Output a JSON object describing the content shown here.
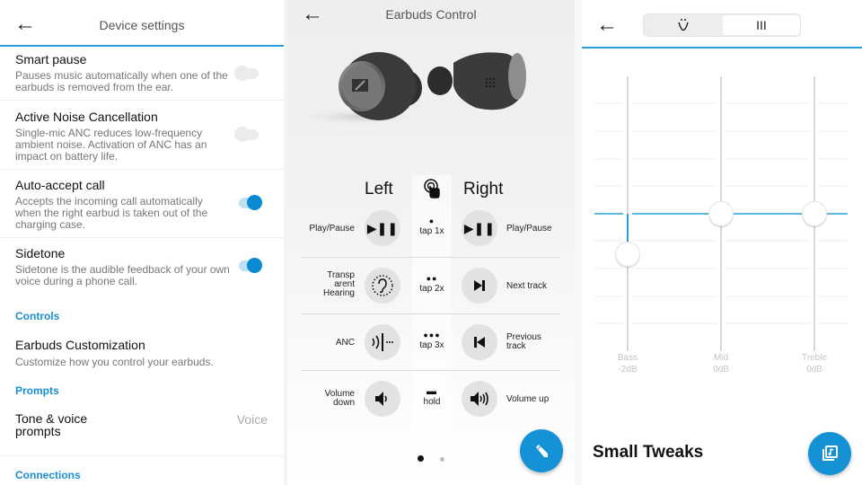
{
  "device_settings": {
    "title": "Device settings",
    "back_icon": "arrow-left",
    "settings": [
      {
        "title": "Smart pause",
        "description": "Pauses music automatically when one of the earbuds is removed from the ear.",
        "enabled": false
      },
      {
        "title": "Active Noise Cancellation",
        "description": "Single-mic ANC reduces low-frequency ambient noise. Activation of ANC has an impact on battery life.",
        "enabled": false
      },
      {
        "title": "Auto-accept call",
        "description": "Accepts the incoming call automatically when the right earbud is taken out of the charging case.",
        "enabled": true
      },
      {
        "title": "Sidetone",
        "description": "Sidetone is the audible feedback of your own voice during a phone call.",
        "enabled": true
      }
    ],
    "sections": {
      "controls": "Controls",
      "prompts": "Prompts",
      "connections": "Connections"
    },
    "earbuds_customization": {
      "title": "Earbuds Customization",
      "description": "Customize how you control your earbuds."
    },
    "tone_voice": {
      "title": "Tone & voice prompts",
      "value": "Voice"
    },
    "accent_color": "#1a8fd0"
  },
  "earbuds_control": {
    "title": "Earbuds Control",
    "back_icon": "arrow-left",
    "left_heading": "Left",
    "right_heading": "Right",
    "gesture_icon": "touch-icon",
    "rows": [
      {
        "left_label": "Play/Pause",
        "left_icon": "play-pause",
        "gesture_dots": "●",
        "gesture": "tap 1x",
        "right_icon": "play-pause",
        "right_label": "Play/Pause"
      },
      {
        "left_label": "Transp arent Hearing",
        "left_icon": "transparent-hearing",
        "gesture_dots": "●●",
        "gesture": "tap 2x",
        "right_icon": "next-track",
        "right_label": "Next track"
      },
      {
        "left_label": "ANC",
        "left_icon": "anc",
        "gesture_dots": "●●●",
        "gesture": "tap 3x",
        "right_icon": "previous-track",
        "right_label": "Previous track"
      },
      {
        "left_label": "Volume down",
        "left_icon": "volume-down",
        "gesture_dots": "▬",
        "gesture": "hold",
        "right_icon": "volume-up",
        "right_label": "Volume up"
      }
    ],
    "pager": {
      "pages": 2,
      "current": 1
    },
    "fab_icon": "pencil-icon",
    "fab_color": "#1592d6"
  },
  "equalizer": {
    "back_icon": "arrow-left",
    "segments": [
      {
        "label": "Ü",
        "icon": "sound-profile-icon",
        "active": false
      },
      {
        "label": "III",
        "icon": "equalizer-bars-icon",
        "active": true
      }
    ],
    "bands": [
      {
        "name": "Bass",
        "value_label": "-2dB",
        "value_db": -2
      },
      {
        "name": "Mid",
        "value_label": "0dB",
        "value_db": 0
      },
      {
        "name": "Treble",
        "value_label": "0dB",
        "value_db": 0
      }
    ],
    "heading": "Small Tweaks",
    "fab_icon": "music-library-icon",
    "accent_color": "#2a9fd6"
  }
}
